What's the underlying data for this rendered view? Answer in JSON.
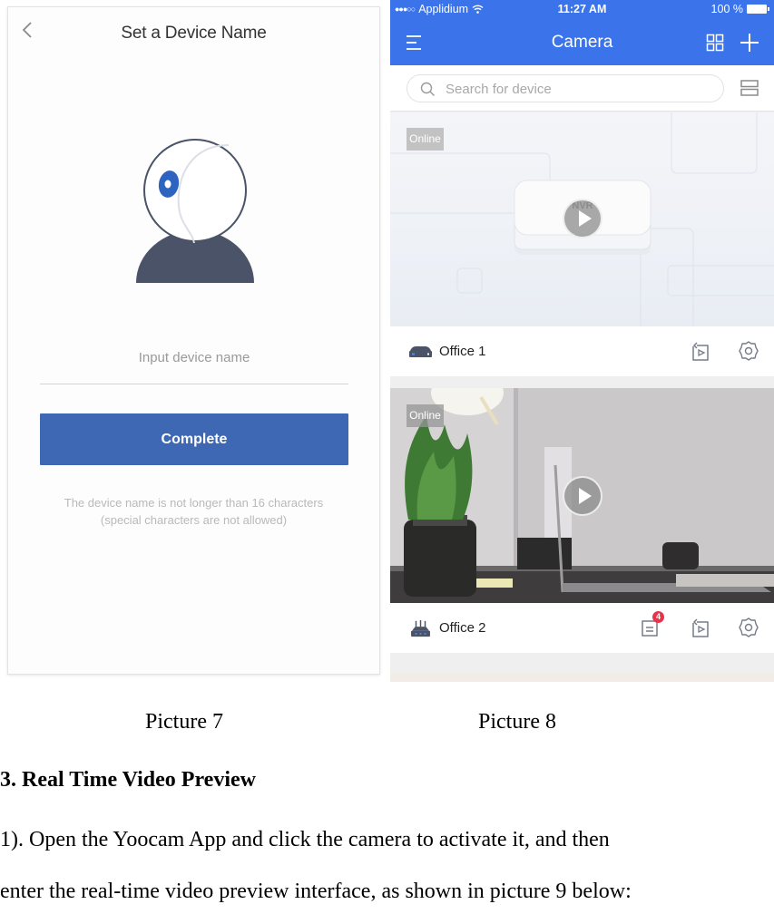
{
  "picture7": {
    "back_icon": "chevron-left-icon",
    "title": "Set a Device Name",
    "illustration": "camera-icon",
    "name_input": {
      "value": "",
      "placeholder": "Input device name"
    },
    "complete_label": "Complete",
    "hint_line1": "The device name is not longer than 16 characters",
    "hint_line2": "(special characters are not allowed)",
    "colors": {
      "button": "#3e68b3",
      "lens": "#2d64c0",
      "base": "#4a5368"
    }
  },
  "picture8": {
    "status_bar": {
      "signal": "●●●○○",
      "carrier": "Applidium",
      "wifi_icon": "wifi-icon",
      "time": "11:27 AM",
      "battery": "100 %"
    },
    "nav": {
      "menu_icon": "menu-icon",
      "title": "Camera",
      "grid_icon": "grid-view-icon",
      "add_icon": "plus-icon"
    },
    "search": {
      "placeholder": "Search for device",
      "value": "",
      "list_icon": "list-view-icon"
    },
    "devices": [
      {
        "name": "Office 1",
        "status": "Online",
        "type_icon": "nvr-icon",
        "thumbnail_label": "NVR",
        "actions": [
          "playback-icon",
          "settings-icon"
        ]
      },
      {
        "name": "Office 2",
        "status": "Online",
        "type_icon": "router-icon",
        "message_count": "4",
        "actions": [
          "messages-icon",
          "playback-icon",
          "settings-icon"
        ]
      }
    ],
    "colors": {
      "header": "#3a73ea",
      "badge": "#e8344a"
    }
  },
  "captions": {
    "picture7": "Picture 7",
    "picture8": "Picture 8"
  },
  "section": {
    "heading": "3. Real Time Video Preview",
    "para_line1": "1). Open the Yoocam App and click the camera to activate it, and then",
    "para_line2": "enter the real-time video preview interface, as shown in picture 9 below:"
  }
}
